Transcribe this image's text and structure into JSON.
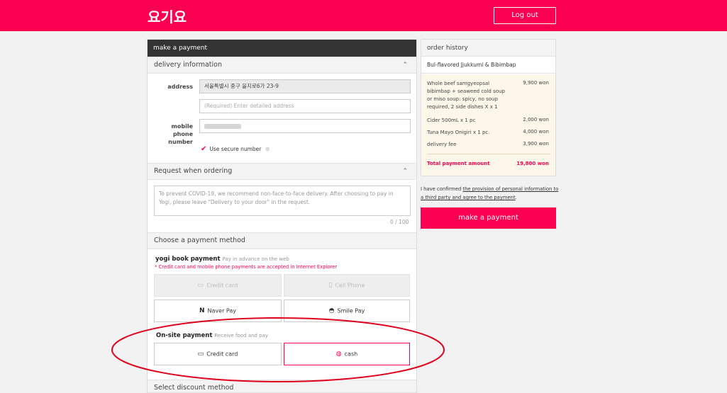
{
  "header": {
    "logo": "요기요",
    "logout_label": "Log out"
  },
  "payment_panel": {
    "title": "make a payment",
    "delivery": {
      "section_title": "delivery information",
      "address_label": "address",
      "address_value": "서울특별시 중구 을지로6가 23-9",
      "detail_placeholder": "(Required) Enter detailed address",
      "phone_label": "mobile phone number",
      "secure_label": "Use secure number",
      "secure_checked": true
    },
    "request": {
      "section_title": "Request when ordering",
      "placeholder": "To prevent COVID-19, we recommend non-face-to-face delivery.  After choosing to pay in Yogi, please leave \"Delivery to your door\" in the request.",
      "counter": "0 / 100"
    },
    "payment_method": {
      "section_title": "Choose a payment method",
      "yogi_title": "yogi book payment",
      "yogi_sub": "Pay in advance on the web",
      "yogi_note": "* Credit card and mobile phone payments are accepted in Internet Explorer",
      "credit_card": "Credit card",
      "cell_phone": "Cell Phone",
      "naver_pay": "Naver Pay",
      "smile_pay": "Smile Pay",
      "onsite_title": "On-site payment",
      "onsite_sub": "Receive food and pay",
      "onsite_credit": "Credit card",
      "onsite_cash": "cash",
      "selected": "cash"
    },
    "discount": {
      "section_title": "Select discount method"
    }
  },
  "order_history": {
    "title": "order history",
    "restaurant": "Bul-flavored Jjukkumi & Bibimbap",
    "items": [
      {
        "name": "Whole beef samgyeopsal bibimbap + seaweed cold soup or miso soup: spicy, no soup required, 2 side dishes X x 1",
        "price": "9,900 won"
      },
      {
        "name": "Cider 500mL x 1 pc",
        "price": "2,000 won"
      },
      {
        "name": "Tuna Mayo Onigiri x 1 pc.",
        "price": "4,000 won"
      },
      {
        "name": "delivery fee",
        "price": "3,900 won"
      }
    ],
    "total_label": "Total payment amount",
    "total_value": "19,800 won"
  },
  "confirm": {
    "prefix": "I have confirmed ",
    "link": "the provision of personal information to a third party and agree to the payment",
    "suffix": "."
  },
  "pay_button": "make a payment",
  "colors": {
    "brand": "#fa0050",
    "annotation": "#e0001b"
  },
  "icons": [
    "check-icon",
    "help-icon",
    "chevron-up-icon",
    "credit-card-icon",
    "phone-icon",
    "naver-icon",
    "smile-icon",
    "cash-icon"
  ]
}
